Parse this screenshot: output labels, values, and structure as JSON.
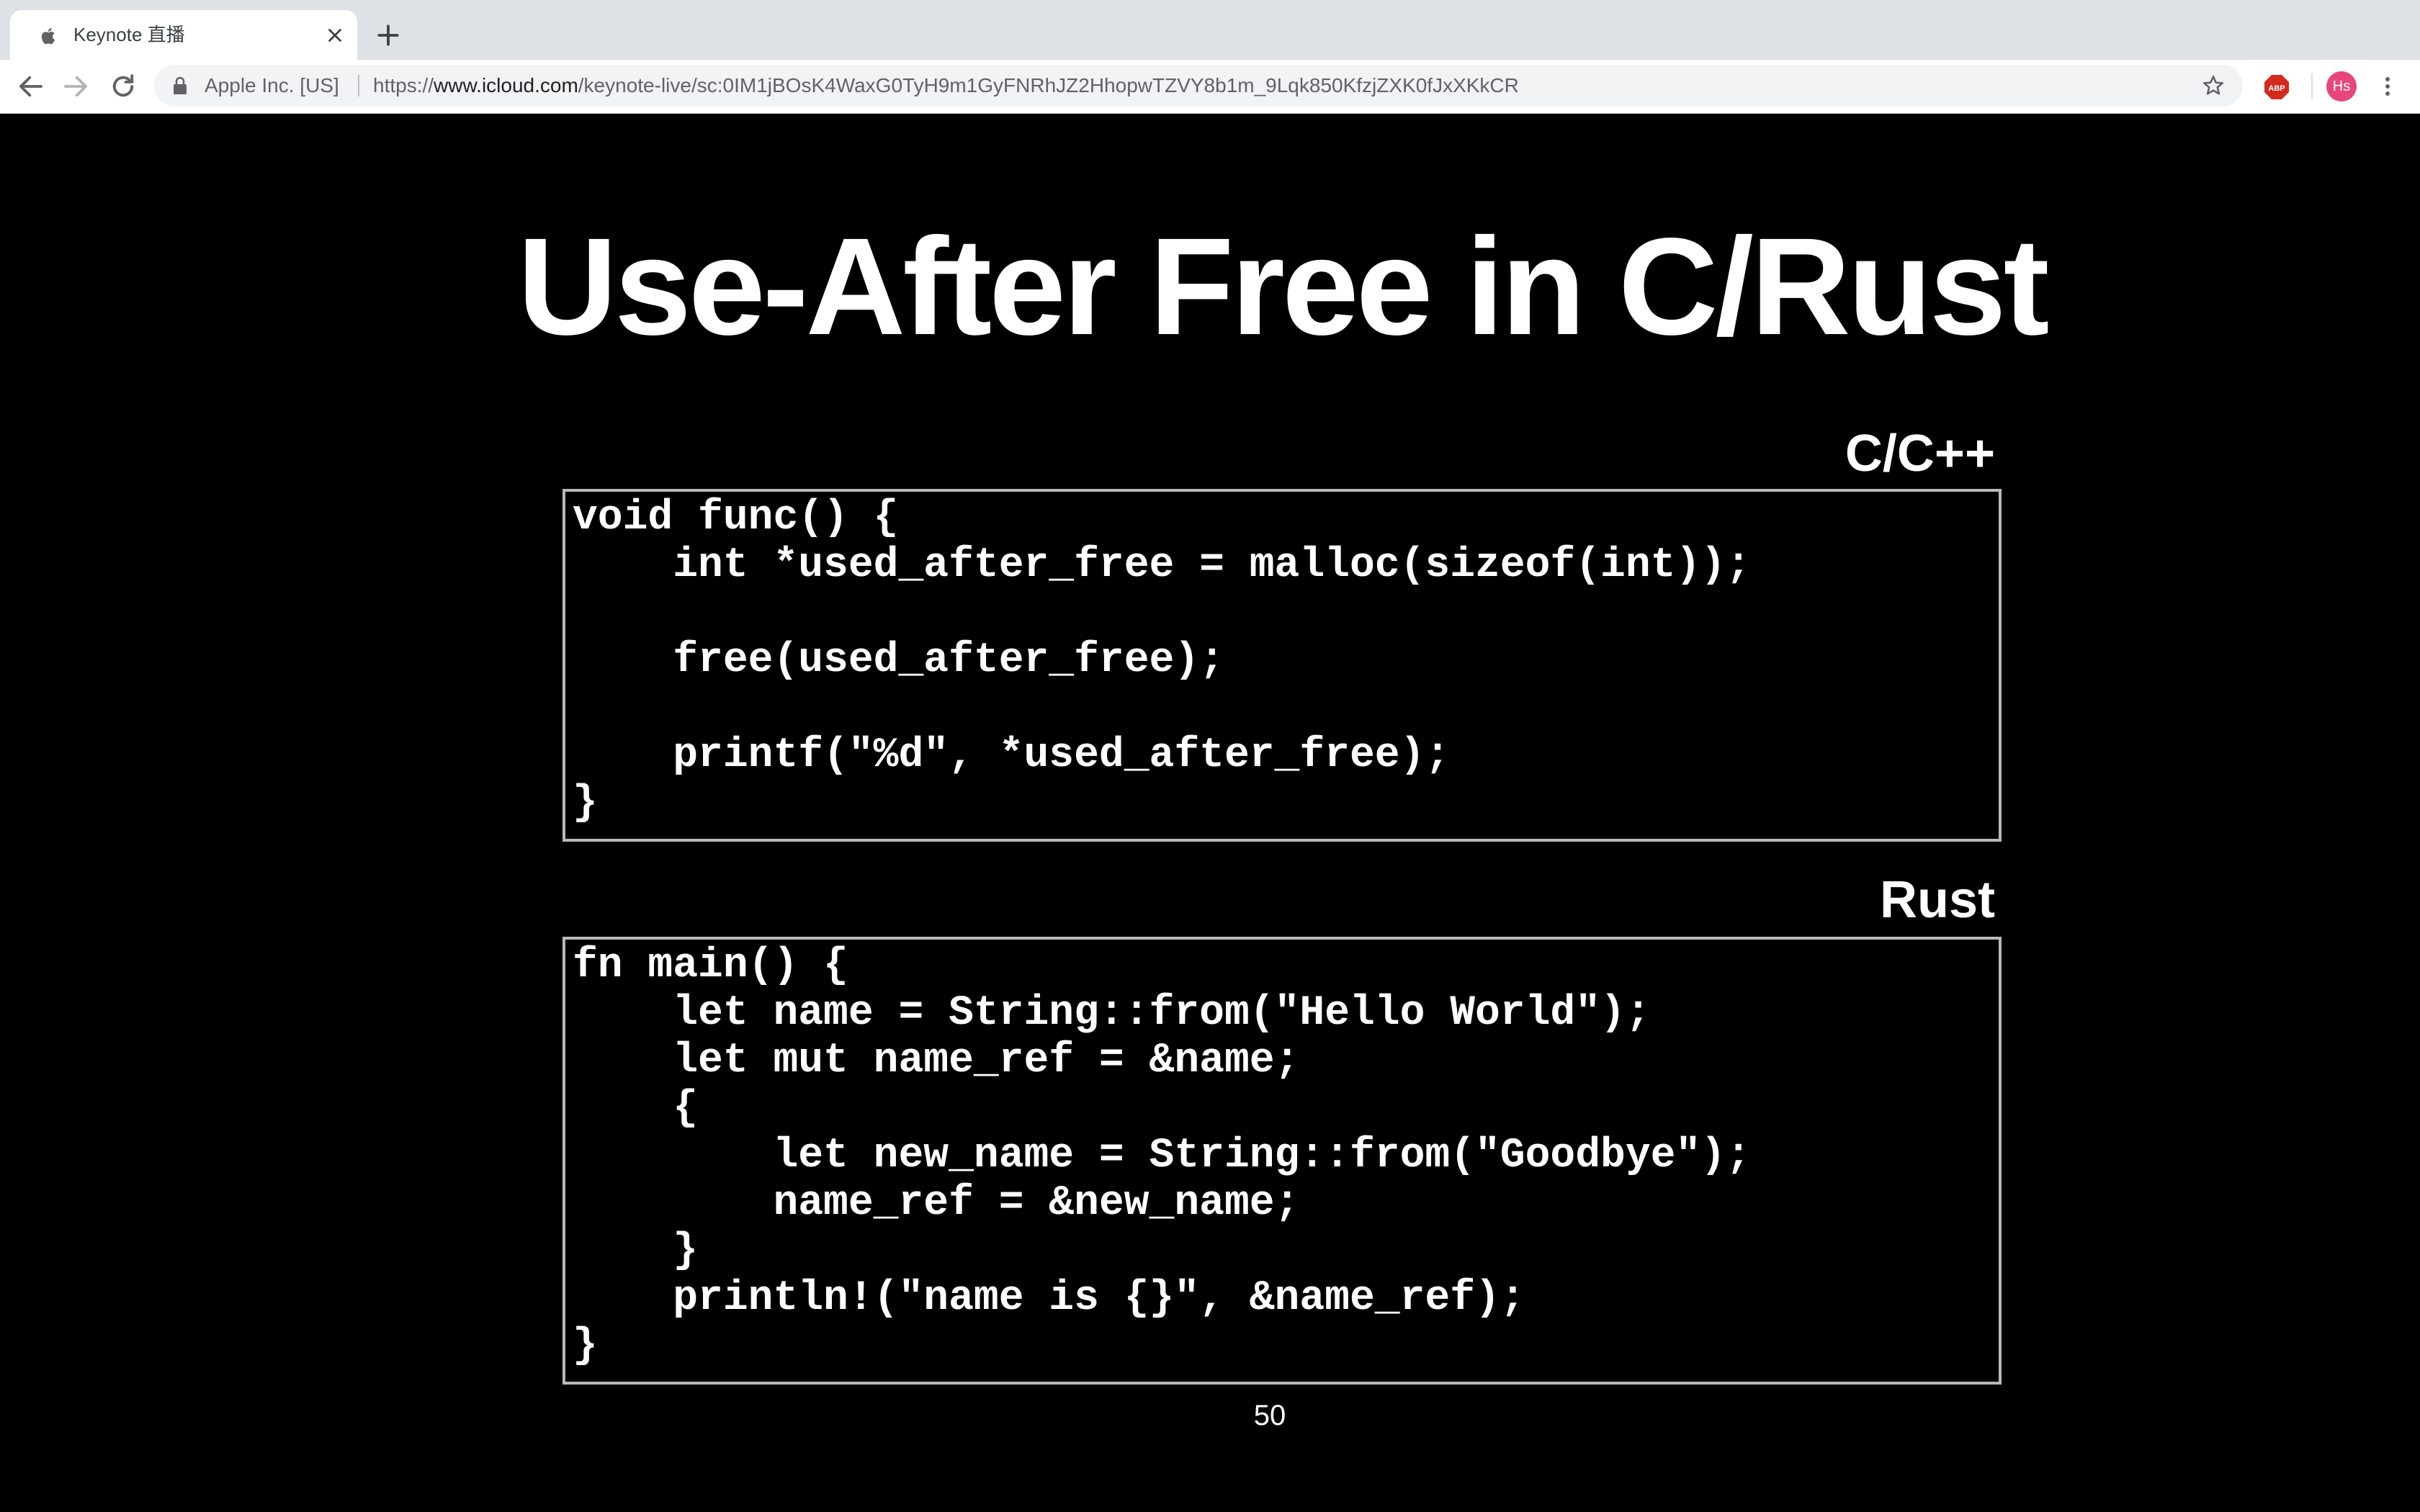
{
  "browser": {
    "tab": {
      "title": "Keynote 直播"
    },
    "address_bar": {
      "certificate": "Apple Inc. [US]",
      "url_prefix": "https://",
      "url_domain": "www.icloud.com",
      "url_path": "/keynote-live/sc:0IM1jBOsK4WaxG0TyH9m1GyFNRhJZ2HhopwTZVY8b1m_9Lqk850KfzjZXK0fJxXKkCR"
    },
    "extensions": {
      "adblock_label": "ABP"
    },
    "profile": {
      "initials": "Hs",
      "color": "#e8457c"
    },
    "icons": {
      "tab_favicon": "apple-icon",
      "tab_close": "close-icon",
      "new_tab": "plus-icon",
      "back": "back-arrow-icon",
      "forward": "forward-arrow-icon",
      "reload": "reload-icon",
      "lock": "lock-icon",
      "bookmark": "star-icon",
      "menu": "kebab-menu-icon"
    }
  },
  "slide": {
    "title": "Use-After Free in C/Rust",
    "c_block": {
      "label": "C/C++",
      "code": "void func() {\n    int *used_after_free = malloc(sizeof(int));\n\n    free(used_after_free);\n\n    printf(\"%d\", *used_after_free);\n}"
    },
    "rust_block": {
      "label": "Rust",
      "code": "fn main() {\n    let name = String::from(\"Hello World\");\n    let mut name_ref = &name;\n    {\n        let new_name = String::from(\"Goodbye\");\n        name_ref = &new_name;\n    }\n    println!(\"name is {}\", &name_ref);\n}"
    },
    "page_number": "50",
    "background_color": "#000000",
    "text_color": "#ffffff"
  }
}
